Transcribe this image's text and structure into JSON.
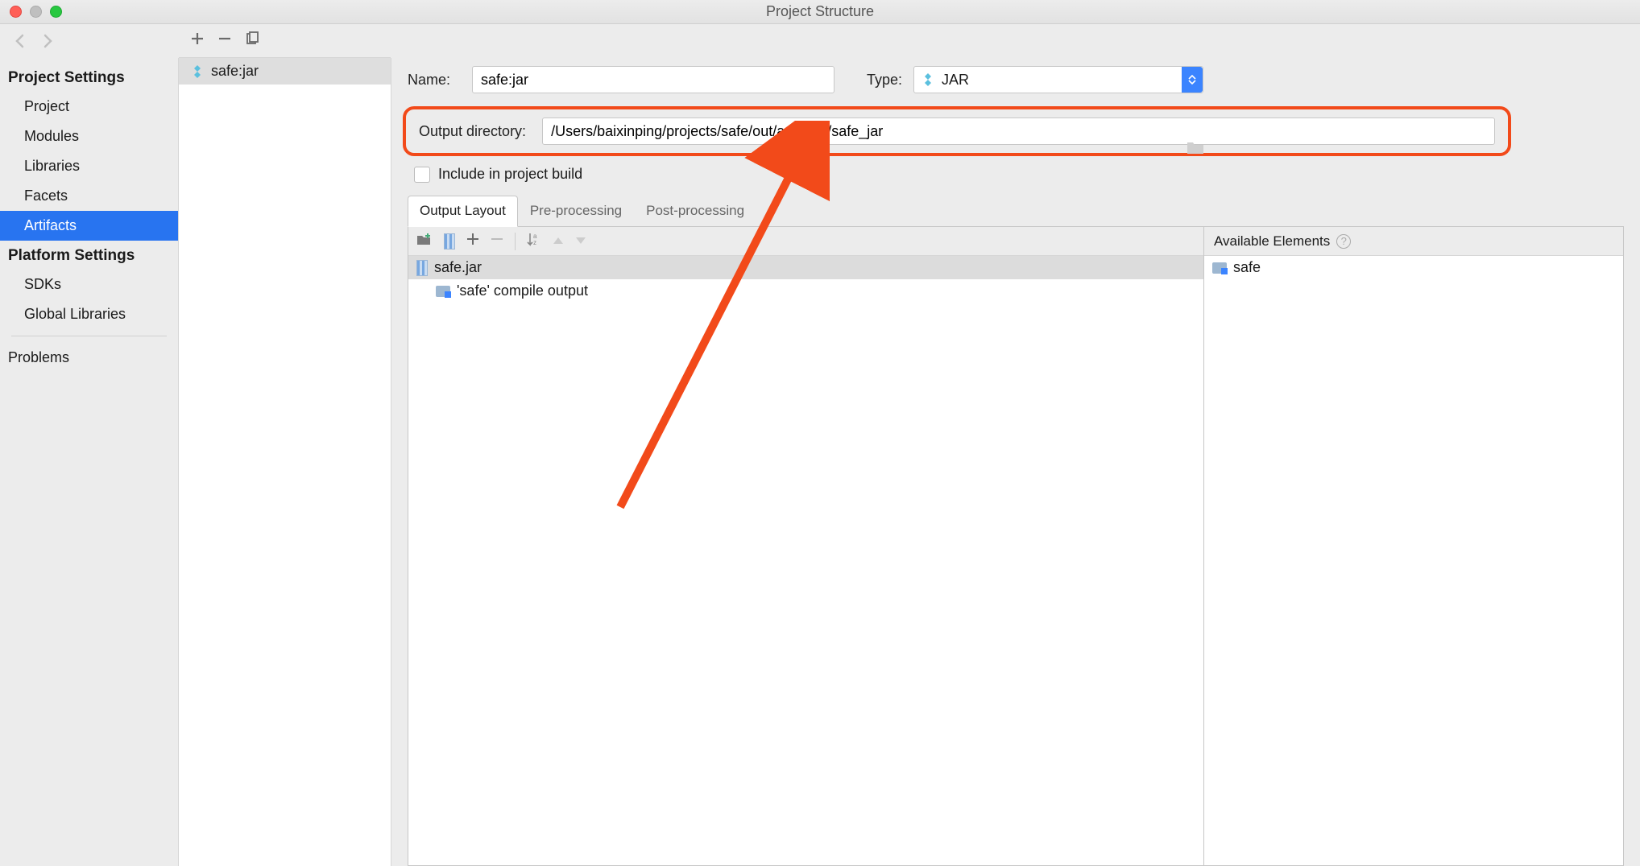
{
  "window": {
    "title": "Project Structure"
  },
  "sidebar": {
    "heading_project": "Project Settings",
    "items_project": [
      "Project",
      "Modules",
      "Libraries",
      "Facets",
      "Artifacts"
    ],
    "selected_project": 4,
    "heading_platform": "Platform Settings",
    "items_platform": [
      "SDKs",
      "Global Libraries"
    ],
    "problems": "Problems"
  },
  "artifact_list": {
    "items": [
      {
        "label": "safe:jar"
      }
    ]
  },
  "form": {
    "name_label": "Name:",
    "name_value": "safe:jar",
    "type_label": "Type:",
    "type_value": "JAR",
    "outdir_label": "Output directory:",
    "outdir_value": "/Users/baixinping/projects/safe/out/artifacts/safe_jar",
    "include_label": "Include in project build"
  },
  "tabs": [
    "Output Layout",
    "Pre-processing",
    "Post-processing"
  ],
  "tabs_active": 0,
  "output_tree": {
    "root": "safe.jar",
    "child": "'safe' compile output"
  },
  "available": {
    "heading": "Available Elements",
    "items": [
      "safe"
    ]
  }
}
